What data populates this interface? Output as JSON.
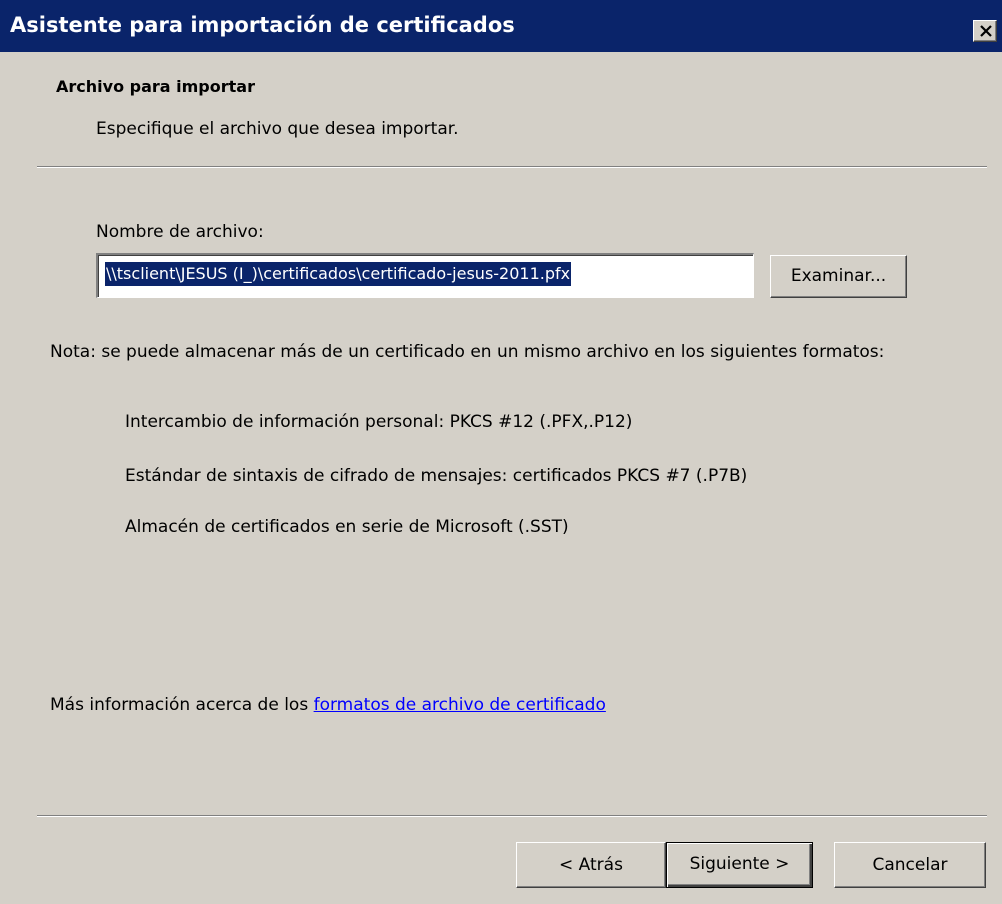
{
  "window": {
    "title": "Asistente para importación de certificados",
    "close_icon": "close-icon"
  },
  "header": {
    "title": "Archivo para importar",
    "subtitle": "Especifique el archivo que desea importar."
  },
  "file": {
    "label": "Nombre de archivo:",
    "value": "\\\\tsclient\\JESUS (I_)\\certificados\\certificado-jesus-2011.pfx",
    "browse_label": "Examinar..."
  },
  "note": {
    "text": "Nota: se puede almacenar más de un certificado en un mismo archivo en los siguientes formatos:",
    "formats": [
      "Intercambio de información personal: PKCS #12 (.PFX,.P12)",
      "Estándar de sintaxis de cifrado de mensajes: certificados PKCS #7 (.P7B)",
      "Almacén de certificados en serie de Microsoft (.SST)"
    ]
  },
  "more_info": {
    "prefix": "Más información acerca de los ",
    "link": "formatos de archivo de certificado"
  },
  "buttons": {
    "back": "< Atrás",
    "next": "Siguiente >",
    "cancel": "Cancelar"
  },
  "colors": {
    "titlebar": "#0a246a",
    "face": "#d4d0c8",
    "link": "#0000ff",
    "selection": "#0a246a"
  }
}
